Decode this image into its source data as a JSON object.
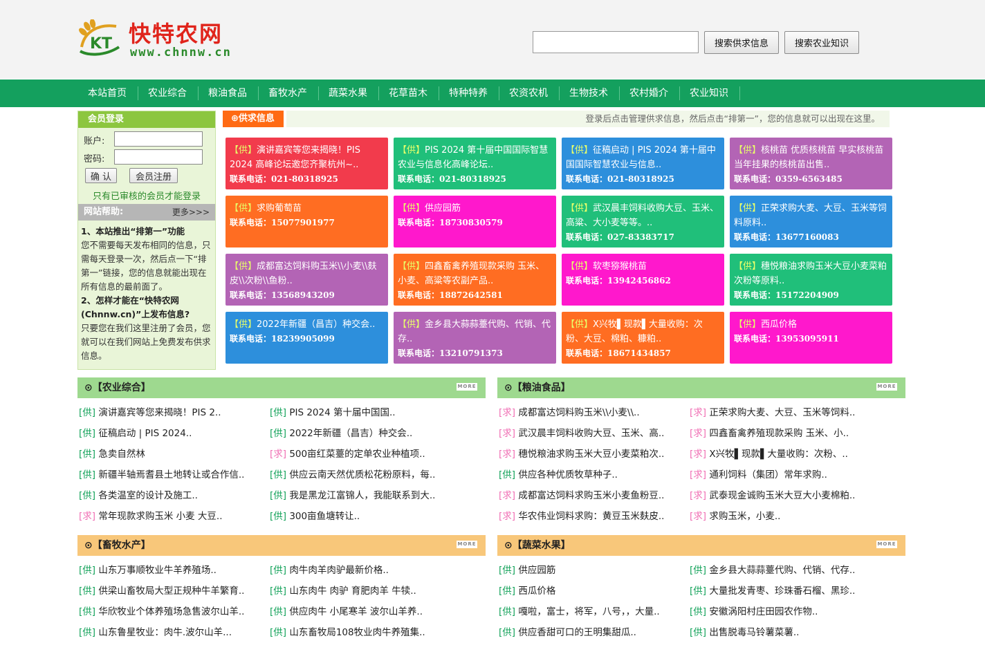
{
  "header": {
    "logo_cn": "快特农网",
    "logo_en": "www.chnnw.cn",
    "logo_mark": "KT",
    "search_placeholder": "",
    "btn_supply": "搜索供求信息",
    "btn_knowledge": "搜索农业知识"
  },
  "nav": [
    "本站首页",
    "农业综合",
    "粮油食品",
    "畜牧水产",
    "蔬菜水果",
    "花草苗木",
    "特种特养",
    "农资农机",
    "生物技术",
    "农村婚介",
    "农业知识"
  ],
  "login": {
    "title": "会员登录",
    "account_label": "账户:",
    "password_label": "密码:",
    "confirm_label": "确 认",
    "register_label": "会员注册",
    "note": "只有已审核的会员才能登录"
  },
  "help": {
    "title": "网站帮助:",
    "more": "更多>>>",
    "q1": "1、本站推出“排第一”功能",
    "a1": "您不需要每天发布相同的信息，只需每天登录一次，然后点一下“排第一”链接，您的信息就能出现在所有信息的最前面了。",
    "q2": "2、怎样才能在“快特农网(Chnnw.cn)”上发布信息?",
    "a2": "只要您在我们这里注册了会员，您就可以在我们网站上免费发布供求信息。"
  },
  "supply": {
    "tab": "⊕供求信息",
    "notice": "登录后点击管理供求信息，然后点击“排第一”，您的信息就可以出现在这里。",
    "tag": "【供】",
    "phone_label": "联系电话：",
    "tiles": [
      {
        "title": "演讲嘉宾等您来揭晓！PIS 2024 高峰论坛邀您齐聚杭州~..",
        "phone": "021-80318925",
        "color": "#f23b4c"
      },
      {
        "title": "PIS 2024 第十届中国国际智慧农业与信息化高峰论坛..",
        "phone": "021-80318925",
        "color": "#20bf7a"
      },
      {
        "title": "征稿启动 | PIS 2024 第十届中国国际智慧农业与信息..",
        "phone": "021-80318925",
        "color": "#2d8fdc"
      },
      {
        "title": "核桃苗 优质核桃苗 早实核桃苗 当年挂果的核桃苗出售..",
        "phone": "0359-6563485",
        "color": "#b364b5"
      },
      {
        "title": "求购葡萄苗",
        "phone": "15077901977",
        "color": "#ff6d22"
      },
      {
        "title": "供应园筋",
        "phone": "18730830579",
        "color": "#ff18cc"
      },
      {
        "title": "武汉晨丰饲料收购大豆、玉米、高粱、大小麦等等。..",
        "phone": "027-83383717",
        "color": "#20bf7a"
      },
      {
        "title": "正荣求购大麦、大豆、玉米等饲料原料..",
        "phone": "13677160083",
        "color": "#2d8fdc"
      },
      {
        "title": "成都富达饲料购玉米\\\\小麦\\\\麸皮\\\\次粉\\\\鱼粉..",
        "phone": "13568943209",
        "color": "#b364b5"
      },
      {
        "title": "四鑫畜禽养殖现款采购 玉米、小麦、高粱等农副产品..",
        "phone": "18872642581",
        "color": "#ff6d22"
      },
      {
        "title": "软枣猕猴桃苗",
        "phone": "13942456862",
        "color": "#ff18cc"
      },
      {
        "title": "穗悦粮油求购玉米大豆小麦菜粕次粉等原料..",
        "phone": "15172204909",
        "color": "#20bf7a"
      },
      {
        "title": "2022年新疆（昌吉）种交会..",
        "phone": "18239905099",
        "color": "#2d8fdc"
      },
      {
        "title": "金乡县大蒜蒜薹代购、代销、代存..",
        "phone": "13210791373",
        "color": "#b364b5"
      },
      {
        "title": "X兴牧▌现款▌大量收购：次粉、大豆、棉粕、糠粕..",
        "phone": "18671434857",
        "color": "#ff6d22"
      },
      {
        "title": "西瓜价格",
        "phone": "13953095911",
        "color": "#ff18cc"
      }
    ]
  },
  "sections": [
    {
      "title": "⊙【农业综合】",
      "more": "MORE",
      "color": "#9ed98f",
      "items": [
        {
          "tag": "[供]",
          "type": "g",
          "text": "演讲嘉宾等您来揭晓！PIS 2.."
        },
        {
          "tag": "[供]",
          "type": "g",
          "text": "PIS 2024 第十届中国国.."
        },
        {
          "tag": "[供]",
          "type": "g",
          "text": "征稿启动 | PIS 2024.."
        },
        {
          "tag": "[供]",
          "type": "g",
          "text": "2022年新疆（昌吉）种交会.."
        },
        {
          "tag": "[供]",
          "type": "g",
          "text": "急卖自然林"
        },
        {
          "tag": "[求]",
          "type": "q",
          "text": "500亩红菜薹的定单农业种植项.."
        },
        {
          "tag": "[供]",
          "type": "g",
          "text": "新疆半轴焉耆县土地转让或合作信.."
        },
        {
          "tag": "[供]",
          "type": "g",
          "text": "供应云南天然优质松花粉原料，每.."
        },
        {
          "tag": "[供]",
          "type": "g",
          "text": "各类温室的设计及施工.."
        },
        {
          "tag": "[供]",
          "type": "g",
          "text": "我是黑龙江富锦人，我能联系到大.."
        },
        {
          "tag": "[求]",
          "type": "q",
          "text": "常年现款求购玉米 小麦 大豆.."
        },
        {
          "tag": "[供]",
          "type": "g",
          "text": "300亩鱼塘转让.."
        }
      ]
    },
    {
      "title": "⊙【粮油食品】",
      "more": "MORE",
      "color": "#9ed98f",
      "items": [
        {
          "tag": "[求]",
          "type": "q",
          "text": "成都富达饲料购玉米\\\\小麦\\\\.."
        },
        {
          "tag": "[求]",
          "type": "q",
          "text": "正荣求购大麦、大豆、玉米等饲料.."
        },
        {
          "tag": "[求]",
          "type": "q",
          "text": "武汉晨丰饲料收购大豆、玉米、高.."
        },
        {
          "tag": "[求]",
          "type": "q",
          "text": "四鑫畜禽养殖现款采购 玉米、小.."
        },
        {
          "tag": "[求]",
          "type": "q",
          "text": "穗悦粮油求购玉米大豆小麦菜粕次.."
        },
        {
          "tag": "[求]",
          "type": "q",
          "text": "X兴牧▌现款▌大量收购：次粉、.."
        },
        {
          "tag": "[供]",
          "type": "g",
          "text": "供应各种优质牧草种子.."
        },
        {
          "tag": "[求]",
          "type": "q",
          "text": "通利饲料（集团）常年求购.."
        },
        {
          "tag": "[求]",
          "type": "q",
          "text": "成都富达饲料求购玉米小麦鱼粉豆.."
        },
        {
          "tag": "[求]",
          "type": "q",
          "text": "武泰现金诚购玉米大豆大小麦棉粕.."
        },
        {
          "tag": "[求]",
          "type": "q",
          "text": "华农伟业饲料求购：黄豆玉米麸皮.."
        },
        {
          "tag": "[求]",
          "type": "q",
          "text": "求购玉米，小麦.."
        }
      ]
    },
    {
      "title": "⊙【畜牧水产】",
      "more": "MORE",
      "color": "#f8c77a",
      "items": [
        {
          "tag": "[供]",
          "type": "g",
          "text": "山东万事顺牧业牛羊养殖场.."
        },
        {
          "tag": "[供]",
          "type": "g",
          "text": "肉牛肉羊肉驴最新价格.."
        },
        {
          "tag": "[供]",
          "type": "g",
          "text": "供梁山畜牧局大型正规种牛羊繁育.."
        },
        {
          "tag": "[供]",
          "type": "g",
          "text": "山东肉牛 肉驴 育肥肉羊 牛犊.."
        },
        {
          "tag": "[供]",
          "type": "g",
          "text": "华欣牧业个体养殖场急售波尔山羊.."
        },
        {
          "tag": "[供]",
          "type": "g",
          "text": "供应肉牛 小尾寒羊 波尔山羊养.."
        },
        {
          "tag": "[供]",
          "type": "g",
          "text": "山东鲁星牧业：肉牛.波尔山羊..."
        },
        {
          "tag": "[供]",
          "type": "g",
          "text": "山东畜牧局108牧业肉牛养殖集.."
        }
      ]
    },
    {
      "title": "⊙【蔬菜水果】",
      "more": "MORE",
      "color": "#f8c77a",
      "items": [
        {
          "tag": "[供]",
          "type": "g",
          "text": "供应园筋"
        },
        {
          "tag": "[供]",
          "type": "g",
          "text": "金乡县大蒜蒜薹代购、代销、代存.."
        },
        {
          "tag": "[供]",
          "type": "g",
          "text": "西瓜价格"
        },
        {
          "tag": "[供]",
          "type": "g",
          "text": "大量批发青枣、珍珠番石榴、黑珍.."
        },
        {
          "tag": "[供]",
          "type": "g",
          "text": "嘎啦，富士，将军，八号，，大量.."
        },
        {
          "tag": "[供]",
          "type": "g",
          "text": "安徽涡阳村庄田园农作物.."
        },
        {
          "tag": "[供]",
          "type": "g",
          "text": "供应香甜可口的王明集甜瓜.."
        },
        {
          "tag": "[供]",
          "type": "g",
          "text": "出售脱毒马铃薯菜薯.."
        }
      ]
    }
  ]
}
